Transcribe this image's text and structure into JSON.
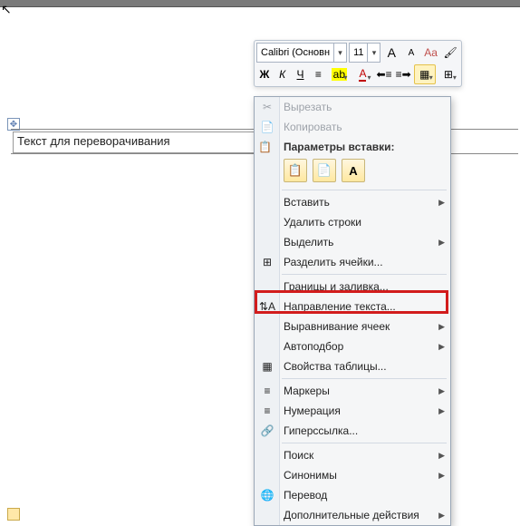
{
  "toolbar": {
    "font_name": "Calibri (Основн",
    "font_size": "11",
    "buttons": {
      "grow": "A",
      "shrink": "A",
      "styles": "≡",
      "bold": "Ж",
      "italic": "К",
      "underline": "Ч",
      "align_center": "≡",
      "highlight": "ab",
      "font_color": "A",
      "indent_dec": "≣",
      "indent_inc": "≣",
      "fill": "▦",
      "border": "⊞",
      "fmt_painter": "✎"
    }
  },
  "cell_text": "Текст для переворачивания",
  "context": {
    "cut": "Вырезать",
    "copy": "Копировать",
    "paste_header": "Параметры вставки:",
    "paste_opts": [
      "📋",
      "📄",
      "A"
    ],
    "insert": "Вставить",
    "delete_rows": "Удалить строки",
    "select": "Выделить",
    "split_cells": "Разделить ячейки...",
    "borders": "Границы и заливка...",
    "text_direction": "Направление текста...",
    "align_cells": "Выравнивание ячеек",
    "autofit": "Автоподбор",
    "table_props": "Свойства таблицы...",
    "bullets": "Маркеры",
    "numbering": "Нумерация",
    "hyperlink": "Гиперссылка...",
    "lookup": "Поиск",
    "synonyms": "Синонимы",
    "translate": "Перевод",
    "more": "Дополнительные действия"
  }
}
